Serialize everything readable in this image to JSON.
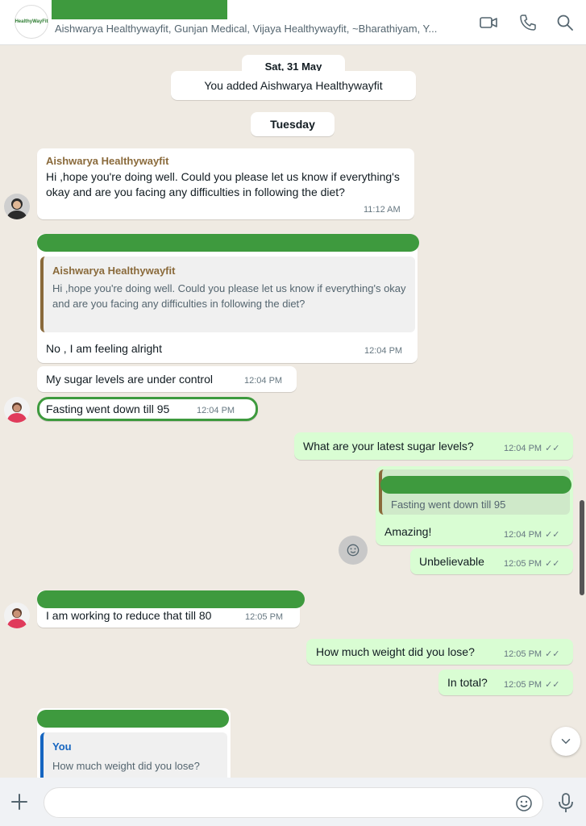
{
  "header": {
    "logo_text": "HealthyWayFit",
    "participants": "Aishwarya Healthywayfit, Gunjan Medical, Vijaya Healthywayfit, ~Bharathiyam, Y...",
    "icons": [
      "video-icon",
      "phone-icon",
      "search-icon"
    ]
  },
  "chat": {
    "date_pill": "Sat, 31 May",
    "system_message": "You added Aishwarya Healthywayfit",
    "day_pill": "Tuesday",
    "msg1": {
      "sender": "Aishwarya Healthywayfit",
      "text": "Hi ,hope you're doing well.  Could you please let us know if everything's okay and are you facing any difficulties in following the diet?",
      "time": "11:12 AM"
    },
    "msg2": {
      "quote_sender": "Aishwarya Healthywayfit",
      "quote_text": "Hi ,hope you're doing well.  Could you please let us know if everything's okay and are you facing any difficulties in following the diet?",
      "text": "No , I am feeling alright",
      "time": "12:04 PM"
    },
    "msg3": {
      "text": "My sugar levels are under control",
      "time": "12:04 PM"
    },
    "msg4": {
      "text": "Fasting went down till 95",
      "time": "12:04 PM"
    },
    "msg5": {
      "text": "What are your latest sugar levels?",
      "time": "12:04 PM"
    },
    "msg6": {
      "quote_text": "Fasting went down till 95",
      "text": "Amazing!",
      "time": "12:04 PM"
    },
    "msg7": {
      "text": "Unbelievable",
      "time": "12:05 PM"
    },
    "msg8": {
      "text": "I am working to reduce that till 80",
      "time": "12:05 PM"
    },
    "msg9": {
      "text": "How much weight did you lose?",
      "time": "12:05 PM"
    },
    "msg10": {
      "text": "In total?",
      "time": "12:05 PM"
    },
    "msg11": {
      "quote_sender": "You",
      "quote_text": "How much weight did you lose?"
    }
  },
  "composer": {
    "value": "",
    "placeholder": ""
  },
  "colors": {
    "accent": "#25d366",
    "outgoing": "#d9fdd3",
    "background": "#efeae2",
    "redaction": "#3e9a3e",
    "sender": "#8a6a3b"
  }
}
